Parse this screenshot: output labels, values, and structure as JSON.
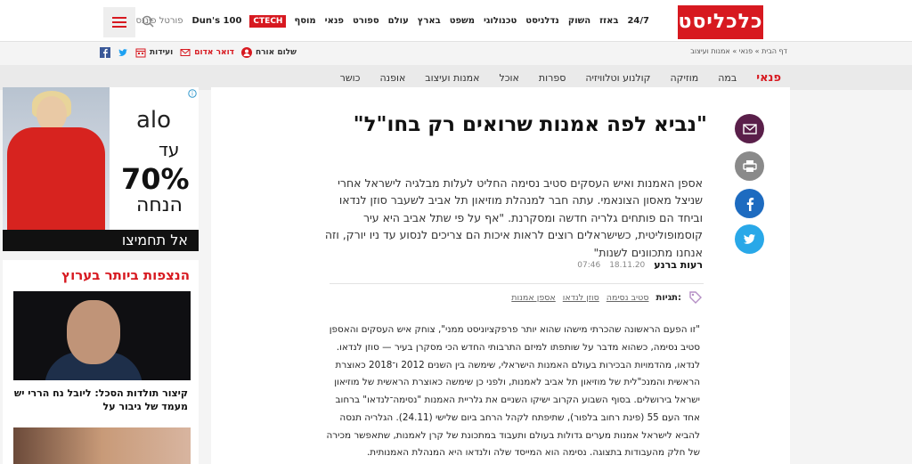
{
  "header": {
    "logo": "כלכליסט",
    "nav": [
      "24/7",
      "באזז",
      "השוק",
      "נדלניסט",
      "טכנולוגי",
      "משפט",
      "בארץ",
      "עולם",
      "ספורט",
      "פנאי",
      "מוסף"
    ],
    "ctech": "CTECH",
    "duns": "Dun's 100",
    "portal": "פורטל פיננסי"
  },
  "subbar": {
    "breadcrumb": "דף הבית » פנאי » אמנות ועיצוב",
    "greeting": "שלום אורח",
    "mail": "דואר אדום",
    "events": "ועידות"
  },
  "section": {
    "main": "פנאי",
    "items": [
      "במה",
      "מוזיקה",
      "קולנוע וטלוויזיה",
      "ספרות",
      "אוכל",
      "אמנות ועיצוב",
      "אופנה",
      "כושר"
    ]
  },
  "ad": {
    "brand": "alo",
    "line1": "עד",
    "line2": "70%",
    "line3": "הנחה",
    "cta": "אל תחמיצו"
  },
  "trending": {
    "title": "הנצפות ביותר בערוץ",
    "caption": "קיצור תולדות הסכל: ליובל נח הררי יש מעמד של גיבור על"
  },
  "article": {
    "title": "\"נביא לפה אמנות שרואים רק בחו\"ל\"",
    "lead": "אספן האמנות ואיש העסקים סטיב נסימה החליט לעלות מבלגיה לישראל אחרי שניצל מאסון הצונאמי. עתה חבר למנהלת מוזיאון תל אביב לשעבר סוזן לנדאו וביחד הם פותחים גלריה חדשה ומסקרנת. \"אף על פי שתל אביב היא עיר קוסמופוליטית, כשישראלים רוצים לראות איכות הם צריכים לנסוע עד ניו יורק, וזה אנחנו מתכוונים לשנות\"",
    "author": "רעות ברנע",
    "date": "18.11.20",
    "time": "07:46",
    "tags_label": "תגיות:",
    "tags": [
      "סטיב נסימה",
      "סוזן לנדאו",
      "אספן אמנות"
    ],
    "body": "\"זו הפעם הראשונה שהכרתי מישהו שהוא יותר פרפקציוניסט ממני\", צוחק איש העסקים והאספן סטיב נסימה, כשהוא מדבר על שותפתו למיזם התרבותי החדש הכי מסקרן בעיר — סוזן לנדאו. לנדאו, מהדמויות הבכירות בעולם האמנות הישראלי, שימשה בין השנים 2012 ו־2018 כאוצרת הראשית והמנכ\"לית של מוזיאון תל אביב לאמנות, ולפני כן שימשה כאוצרת הראשית של מוזיאון ישראל בירושלים. בסוף השבוע הקרוב ישיקו השניים את גלריית האמנות \"נסימה־לנדאו\" ברחוב אחד העם 55 (פינת רחוב בלפור), שתיפתח לקהל הרחב ביום שלישי (24.11). הגלריה תנסה להביא לישראל אמנות מערים גדולות בעולם ותעבוד במתכונת של קרן לאמנות, שתאפשר מכירה של חלק מהעבודות בתצוגה. נסימה הוא המייסד שלה ולנדאו היא המנהלת האמנותית."
  }
}
